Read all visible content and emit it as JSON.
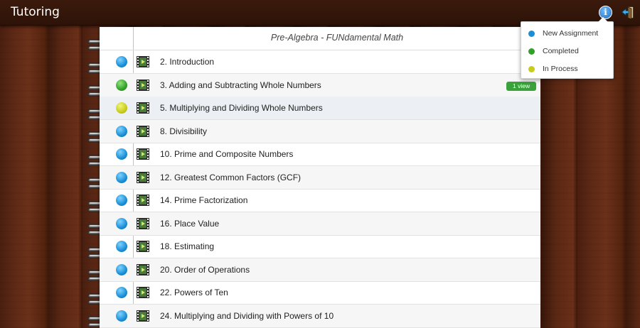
{
  "app": {
    "title": "Tutoring"
  },
  "toolbar": {
    "info_icon_glyph": "i"
  },
  "notebook": {
    "title": "Pre-Algebra - FUNdamental Math",
    "rows": [
      {
        "label": "2. Introduction",
        "status": "new",
        "badge": ""
      },
      {
        "label": "3. Adding and Subtracting Whole Numbers",
        "status": "completed",
        "badge": "1 view"
      },
      {
        "label": "5. Multiplying and Dividing Whole Numbers",
        "status": "inprocess",
        "badge": ""
      },
      {
        "label": "8. Divisibility",
        "status": "new",
        "badge": ""
      },
      {
        "label": "10. Prime and Composite Numbers",
        "status": "new",
        "badge": ""
      },
      {
        "label": "12. Greatest Common Factors (GCF)",
        "status": "new",
        "badge": ""
      },
      {
        "label": "14. Prime Factorization",
        "status": "new",
        "badge": ""
      },
      {
        "label": "16. Place Value",
        "status": "new",
        "badge": ""
      },
      {
        "label": "18. Estimating",
        "status": "new",
        "badge": ""
      },
      {
        "label": "20. Order of Operations",
        "status": "new",
        "badge": ""
      },
      {
        "label": "22. Powers of Ten",
        "status": "new",
        "badge": ""
      },
      {
        "label": "24. Multiplying and Dividing with Powers of 10",
        "status": "new",
        "badge": ""
      }
    ]
  },
  "legend": {
    "items": [
      {
        "label": "New Assignment",
        "color": "#1a8fd6"
      },
      {
        "label": "Completed",
        "color": "#34a02a"
      },
      {
        "label": "In Process",
        "color": "#c9cc1a"
      }
    ]
  }
}
